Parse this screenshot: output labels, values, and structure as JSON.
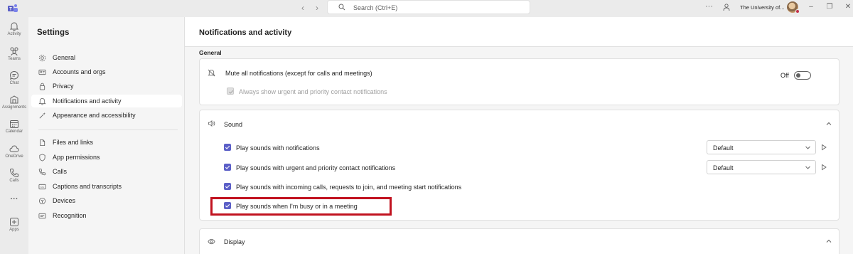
{
  "titlebar": {
    "search_placeholder": "Search (Ctrl+E)",
    "org_name": "The University of...",
    "more_label": "···"
  },
  "rail": {
    "items": [
      {
        "label": "Activity",
        "icon": "bell-icon"
      },
      {
        "label": "Teams",
        "icon": "teams-icon"
      },
      {
        "label": "Chat",
        "icon": "chat-icon"
      },
      {
        "label": "Assignments",
        "icon": "assignments-icon"
      },
      {
        "label": "Calendar",
        "icon": "calendar-icon"
      },
      {
        "label": "OneDrive",
        "icon": "cloud-icon"
      },
      {
        "label": "Calls",
        "icon": "phone-icon"
      },
      {
        "label": "···",
        "icon": "more-icon"
      },
      {
        "label": "Apps",
        "icon": "apps-icon"
      }
    ]
  },
  "settings": {
    "title": "Settings",
    "items": [
      {
        "label": "General",
        "icon": "gear-icon"
      },
      {
        "label": "Accounts and orgs",
        "icon": "accounts-icon"
      },
      {
        "label": "Privacy",
        "icon": "lock-icon"
      },
      {
        "label": "Notifications and activity",
        "icon": "bell-icon",
        "selected": true
      },
      {
        "label": "Appearance and accessibility",
        "icon": "wand-icon"
      },
      {
        "label": "Files and links",
        "icon": "file-icon"
      },
      {
        "label": "App permissions",
        "icon": "shield-icon"
      },
      {
        "label": "Calls",
        "icon": "phone-icon"
      },
      {
        "label": "Captions and transcripts",
        "icon": "cc-icon"
      },
      {
        "label": "Devices",
        "icon": "devices-icon"
      },
      {
        "label": "Recognition",
        "icon": "recognition-icon"
      }
    ]
  },
  "main": {
    "title": "Notifications and activity",
    "section": "General",
    "mute": {
      "label": "Mute all notifications (except for calls and meetings)",
      "toggle_label": "Off",
      "toggle_on": false,
      "urgent_label": "Always show urgent and priority contact notifications",
      "urgent_checked": true,
      "urgent_disabled": true
    },
    "sound": {
      "title": "Sound",
      "rows": [
        {
          "label": "Play sounds with notifications",
          "checked": true,
          "select_value": "Default"
        },
        {
          "label": "Play sounds with urgent and priority contact notifications",
          "checked": true,
          "select_value": "Default"
        },
        {
          "label": "Play sounds with incoming calls, requests to join, and meeting start notifications",
          "checked": true
        },
        {
          "label": "Play sounds when I'm busy or in a meeting",
          "checked": true
        }
      ]
    },
    "display": {
      "title": "Display"
    }
  },
  "colors": {
    "accent": "#5b5fc7",
    "highlight": "#c1121f",
    "teams_brand": "#5b5fc7"
  }
}
